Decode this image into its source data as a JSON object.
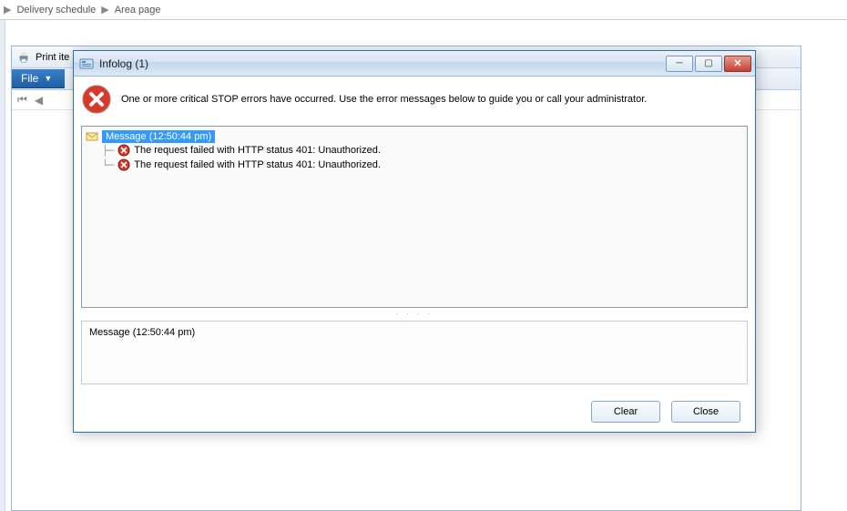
{
  "breadcrumb": {
    "item1": "Delivery schedule",
    "item2": "Area page"
  },
  "back": {
    "print_label": "Print ite",
    "file_label": "File"
  },
  "dialog": {
    "title": "Infolog (1)",
    "header_message": "One or more critical STOP errors have occurred. Use the error messages below to guide you or call your administrator.",
    "tree": {
      "root": "Message (12:50:44 pm)",
      "items": [
        "The request failed with HTTP status 401: Unauthorized.",
        "The request failed with HTTP status 401: Unauthorized."
      ]
    },
    "detail": "Message (12:50:44 pm)",
    "buttons": {
      "clear": "Clear",
      "close": "Close"
    }
  }
}
